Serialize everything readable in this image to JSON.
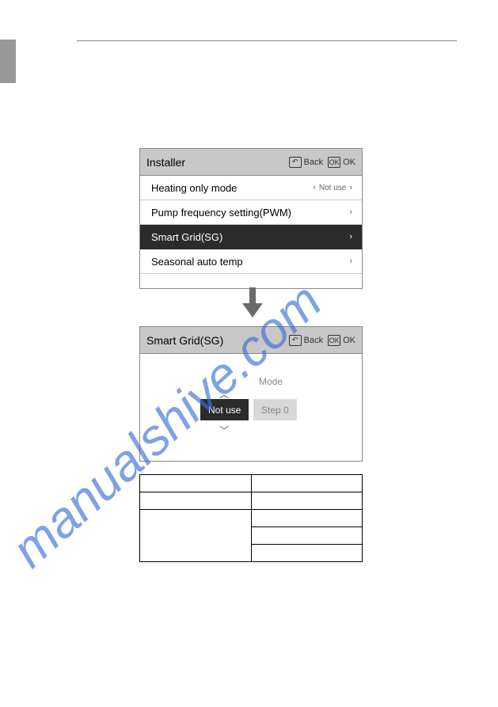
{
  "watermark": "manualshive.com",
  "header_buttons": {
    "back_label": "Back",
    "ok_label": "OK",
    "back_icon_glyph": "↶",
    "ok_icon_glyph": "OK"
  },
  "panel1": {
    "title": "Installer",
    "items": [
      {
        "label": "Heating only mode",
        "value": "Not use",
        "has_left_chev": true
      },
      {
        "label": "Pump frequency setting(PWM)"
      },
      {
        "label": "Smart Grid(SG)",
        "selected": true
      },
      {
        "label": "Seasonal auto temp"
      }
    ],
    "cut_label": ""
  },
  "panel2": {
    "title": "Smart Grid(SG)",
    "mode_label": "Mode",
    "value_primary": "Not use",
    "value_secondary": "Step 0"
  },
  "table": {
    "rows": [
      [
        "",
        ""
      ],
      [
        "",
        ""
      ],
      [
        "",
        ""
      ],
      [
        "",
        ""
      ],
      [
        "",
        ""
      ]
    ]
  }
}
